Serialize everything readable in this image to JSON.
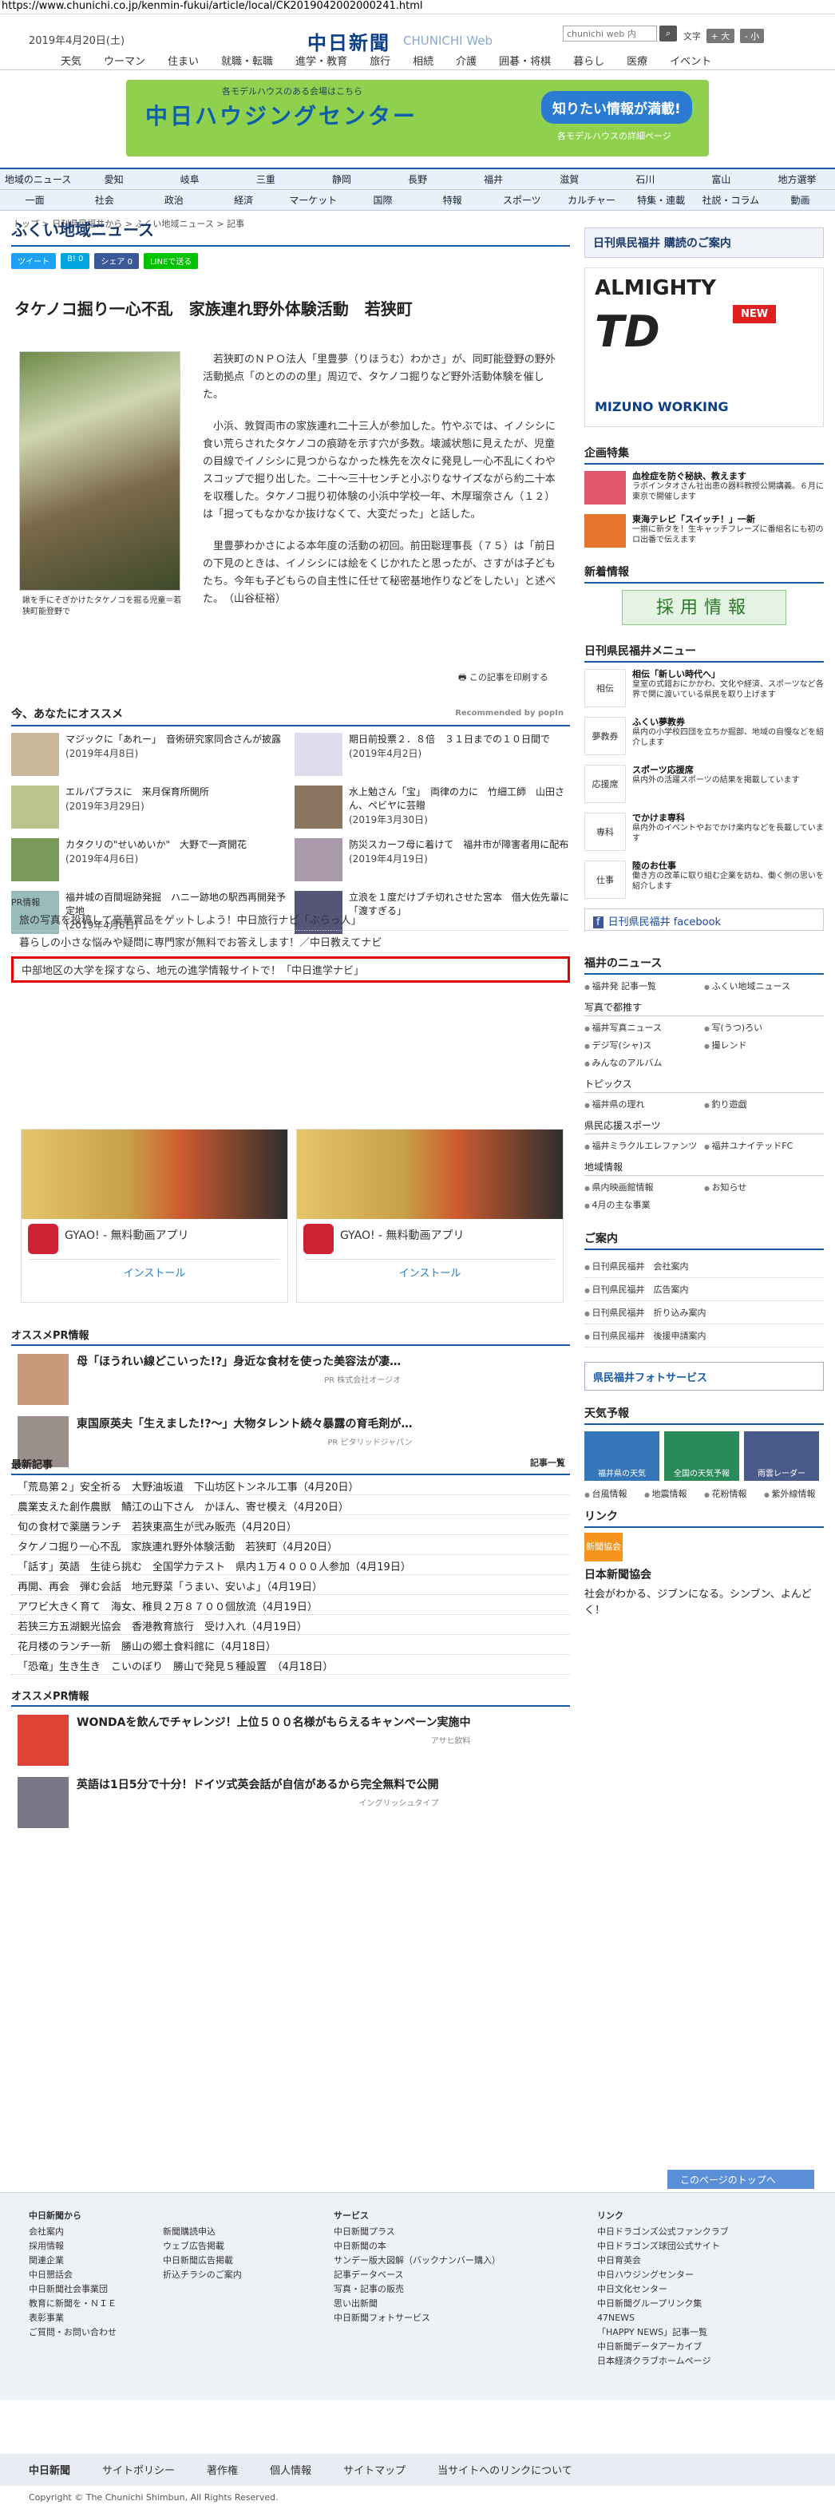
{
  "browser": {
    "url": "https://www.chunichi.co.jp/kenmin-fukui/article/local/CK2019042002000241.html"
  },
  "header": {
    "date": "2019年4月20日(土)",
    "logo": "中日新聞",
    "logo_sub": "CHUNICHI Web",
    "search_placeholder": "chunichi web 内",
    "search_button": "検索",
    "tools": "文字",
    "zoom_in": "+ 大",
    "zoom_out": "- 小"
  },
  "global_nav": [
    "天気",
    "ウーマン",
    "住まい",
    "就職・転職",
    "進学・教育",
    "旅行",
    "相続",
    "介護",
    "囲碁・将棋",
    "暮らし",
    "医療",
    "イベント"
  ],
  "banner": {
    "title": "中日ハウジングセンター",
    "badge": "知りたい情報が満載!",
    "sub": "各モデルハウスの詳細ページ",
    "top": "各モデルハウスのある会場はこちら"
  },
  "sub_nav_row1": [
    "地域のニュース",
    "愛知",
    "岐阜",
    "三重",
    "静岡",
    "長野",
    "福井",
    "滋賀",
    "石川",
    "富山",
    "地方選挙"
  ],
  "sub_nav_row2": [
    "一面",
    "社会",
    "政治",
    "経済",
    "マーケット",
    "国際",
    "特報",
    "スポーツ",
    "カルチャー",
    "特集・連載",
    "社説・コラム",
    "動画"
  ],
  "breadcrumb": "トップ > 日刊県民福井から > ふくい地域ニュース > 記事",
  "page_title": "ふくい地域ニュース",
  "share": {
    "tweet": "ツイート",
    "hatena": "B! 0",
    "facebook": "シェア 0",
    "line": "LINEで送る"
  },
  "article": {
    "date": "2019年4月20日",
    "headline": "タケノコ掘り一心不乱　家族連れ野外体験活動　若狭町",
    "caption": "鍬を手にそぎかけたタケノコを掘る児童＝若狭町能登野で",
    "paragraphs": [
      "若狭町のＮＰＯ法人「里豊夢（りほうむ）わかさ」が、同町能登野の野外活動拠点「のとののの里」周辺で、タケノコ掘りなど野外活動体験を催した。",
      "小浜、敦賀両市の家族連れ二十三人が参加した。竹やぶでは、イノシシに食い荒らされたタケノコの痕跡を示す穴が多数。壊滅状態に見えたが、児童の目線でイノシシに見つからなかった株先を次々に発見し一心不乱にくわやスコップで掘り出した。二十〜三十センチと小ぶりなサイズながら約二十本を収穫した。タケノコ掘り初体験の小浜中学校一年、木厚瑠奈さん（１２）は「掘ってもなかなか抜けなくて、大変だった」と話した。",
      "里豊夢わかさによる本年度の活動の初回。前田聡理事長（７５）は「前日の下見のときは、イノシシには絵をくじかれたと思ったが、さすがは子どもたち。今年も子どもらの自主性に任せて秘密基地作りなどをしたい」と述べた。　（山谷柾裕）"
    ],
    "print": "この記事を印刷する"
  },
  "recommend": {
    "title": "今、あなたにオススメ",
    "powered": "Recommended by popIn",
    "items": [
      {
        "title": "マジックに「あれー」　音術研究家同合さんが披露",
        "date": "(2019年4月8日)"
      },
      {
        "title": "期日前投票２．８倍　３１日までの１０日間で",
        "date": "(2019年4月2日)"
      },
      {
        "title": "エルパプラスに　来月保育所開所",
        "date": "(2019年3月29日)"
      },
      {
        "title": "水上勉さん「宝」　両律の力に　竹細工師　山田さん、ペビヤに芸贈",
        "date": "(2019年3月30日)"
      },
      {
        "title": "カタクリの\"せいめいか\"　大野で一斉開花",
        "date": "(2019年4月6日)"
      },
      {
        "title": "防災スカーフ母に着けて　福井市が障害者用に配布",
        "date": "(2019年4月19日)"
      },
      {
        "title": "福井城の百間堀跡発掘　ハニー跡地の駅西再開発予定地",
        "date": "(2019年4月6日)"
      },
      {
        "title": "立浪を１度だけブチ切れさせた宮本　借大佐先輩に「渡すぎる」",
        "date": ""
      }
    ]
  },
  "pr": {
    "label": "PR情報",
    "lines": [
      "旅の写真を投稿して豪華賞品をゲットしよう！中日旅行ナビ「ぶらっ人」",
      "暮らしの小さな悩みや疑問に専門家が無料でお答えします！／中日教えてナビ",
      "中部地区の大学を探すなら、地元の進学情報サイトで！「中日進学ナビ」"
    ]
  },
  "ads": [
    {
      "name": "GYAO! - 無料動画アプリ",
      "install": "インストール"
    },
    {
      "name": "GYAO! - 無料動画アプリ",
      "install": "インストール"
    }
  ],
  "osusume": {
    "title": "オススメPR情報",
    "items": [
      {
        "title": "母「ほうれい線どこいった!?」身近な食材を使った美容法が凄…",
        "sponsor": "PR 株式会社オージオ"
      },
      {
        "title": "東国原英夫「生えました!?〜」大物タレント続々暴露の育毛剤が…",
        "sponsor": "PR ピタリッドジャパン"
      }
    ]
  },
  "latest": {
    "title": "最新記事",
    "list_link": "記事一覧",
    "items": [
      "「荒島第２」安全祈る　大野油坂道　下山坊区トンネル工事（4月20日）",
      "農業支えた創作農獣　鯖江の山下さん　かほん、寄せ模え（4月20日）",
      "旬の食材で薬膳ランチ　若狭東高生が弐み販売（4月20日）",
      "タケノコ掘り一心不乱　家族連れ野外体験活動　若狭町（4月20日）",
      "「話す」英語　生徒ら挑む　全国学力テスト　県内１万４０００人参加（4月19日）",
      "再開、再会　弾む会話　地元野菜「うまい、安いよ」（4月19日）",
      "アワビ大きく育て　海女、稚貝２万８７００個放流（4月19日）",
      "若狭三方五湖観光協会　香港教育旅行　受け入れ（4月19日）",
      "花月楼のランチ一新　勝山の郷土食料館に（4月18日）",
      "「恐竜」生き生き　こいのぼり　勝山で発見５種設置　（4月18日）"
    ]
  },
  "osusume2": {
    "title": "オススメPR情報",
    "items": [
      {
        "title": "WONDAを飲んでチャレンジ！上位５００名様がもらえるキャンペーン実施中",
        "sponsor": "アサヒ飲料"
      },
      {
        "title": "英語は1日5分で十分！ドイツ式英会話が自信があるから完全無料で公開",
        "sponsor": "イングリッシュタイプ"
      }
    ]
  },
  "sidebar": {
    "subscribe": "日刊県民福井 購読のご案内",
    "ad": {
      "title": "ALMIGHTY",
      "brand": "TD",
      "new": "NEW",
      "footer": "MIZUNO WORKING"
    },
    "kikaku": {
      "title": "企画特集",
      "items": [
        {
          "title": "血栓症を防ぐ秘訣、教えます",
          "desc": "ラボインタオさん社出患の器料教授公開講義。６月に東京で開催します"
        },
        {
          "title": "東海テレビ「スイッチ！」一新",
          "desc": "一揃に新タを！生キャッチフレーズに番組名にも初のロ出番で伝えます"
        }
      ]
    },
    "shinchaku": {
      "title": "新着情報",
      "recruit": "採用情報"
    },
    "menu": {
      "title": "日刊県民福井メニュー",
      "items": [
        {
          "title": "相伝「新しい時代へ」",
          "desc": "皇室の式錯おにかかわ、文化や経済、スポーツなど各界で関に渡いている県民を取り上げます",
          "thumb": "相伝"
        },
        {
          "title": "ふくい夢教券",
          "desc": "県内の小学校四団を立ちか掘部、地域の自慢などを紹介します",
          "thumb": "夢教券"
        },
        {
          "title": "スポーツ応援席",
          "desc": "県内外の活躍スポーツの結果を掲載しています",
          "thumb": "応援席"
        },
        {
          "title": "でかけま専科",
          "desc": "県内外のイベントやおでかけ楽内などを長載しています",
          "thumb": "専科"
        },
        {
          "title": "陸のお仕事",
          "desc": "働き方の改革に取り組む企業を訪ね、働く側の思いを紹介します",
          "thumb": "仕事"
        }
      ]
    },
    "facebook": "日刊県民福井 facebook",
    "fukui_news": {
      "title": "福井のニュース",
      "links": [
        "福井発 記事一覧",
        "ふくい地域ニュース"
      ],
      "photo_title": "写真で都推す",
      "photo_links": [
        "福井写真ニュース",
        "写(うつ)ろい",
        "デジ写(シャ)ス",
        "撮レンド",
        "みんなのアルバム"
      ],
      "topics_title": "トピックス",
      "topics": [
        "福井県の理れ",
        "釣り遊戯"
      ],
      "sports_title": "県民応援スポーツ",
      "sports": [
        "福井ミラクルエレファンツ",
        "福井ユナイテッドFC"
      ],
      "info_title": "地域情報",
      "info": [
        "県内映画館情報",
        "お知らせ",
        "4月の主な事業"
      ]
    },
    "guide": {
      "title": "ご案内",
      "items": [
        "日刊県民福井　会社案内",
        "日刊県民福井　広告案内",
        "日刊県民福井　折り込み案内",
        "日刊県民福井　後援申請案内"
      ]
    },
    "photoservice": "県民福井フォトサービス",
    "weather": {
      "title": "天気予報",
      "tiles": [
        "福井県の天気",
        "全国の天気予報",
        "雨雲レーダー"
      ],
      "links": [
        "台風情報",
        "地震情報",
        "花粉情報",
        "紫外線情報"
      ]
    },
    "link": {
      "title": "リンク",
      "icon": "新聞協会",
      "name": "日本新聞協会",
      "desc": "社会がわかる、ジブンになる。シンブン、よんどく！"
    }
  },
  "footer": {
    "back_to_top": "このページのトップへ",
    "col1_title": "中日新聞から",
    "col1": [
      "会社案内",
      "採用情報",
      "関連企業",
      "中日懇話会",
      "中日新聞社会事業団",
      "教育に新聞を・ＮＩＥ",
      "表彰事業",
      "ご質問・お問い合わせ"
    ],
    "col2": [
      "新聞購読申込",
      "ウェブ広告掲載",
      "中日新聞広告掲載",
      "折込チラシのご案内"
    ],
    "col3_title": "サービス",
    "col3": [
      "中日新聞プラス",
      "中日新聞の本",
      "サンデー版大図解（バックナンバー購入）",
      "記事データベース",
      "写真・記事の販売",
      "思い出新聞",
      "中日新聞フォトサービス"
    ],
    "col4_title": "リンク",
    "col4": [
      "中日ドラゴンズ公式ファンクラブ",
      "中日ドラゴンズ球団公式サイト",
      "中日育英会",
      "中日ハウジングセンター",
      "中日文化センター",
      "中日新聞グループリンク集",
      "47NEWS",
      "「HAPPY NEWS」記事一覧",
      "中日新聞データアーカイブ",
      "日本経済クラブホームページ"
    ],
    "bottom": [
      "中日新聞",
      "サイトポリシー",
      "著作権",
      "個人情報",
      "サイトマップ",
      "当サイトへのリンクについて"
    ],
    "copyright": "Copyright © The Chunichi Shimbun, All Rights Reserved."
  }
}
